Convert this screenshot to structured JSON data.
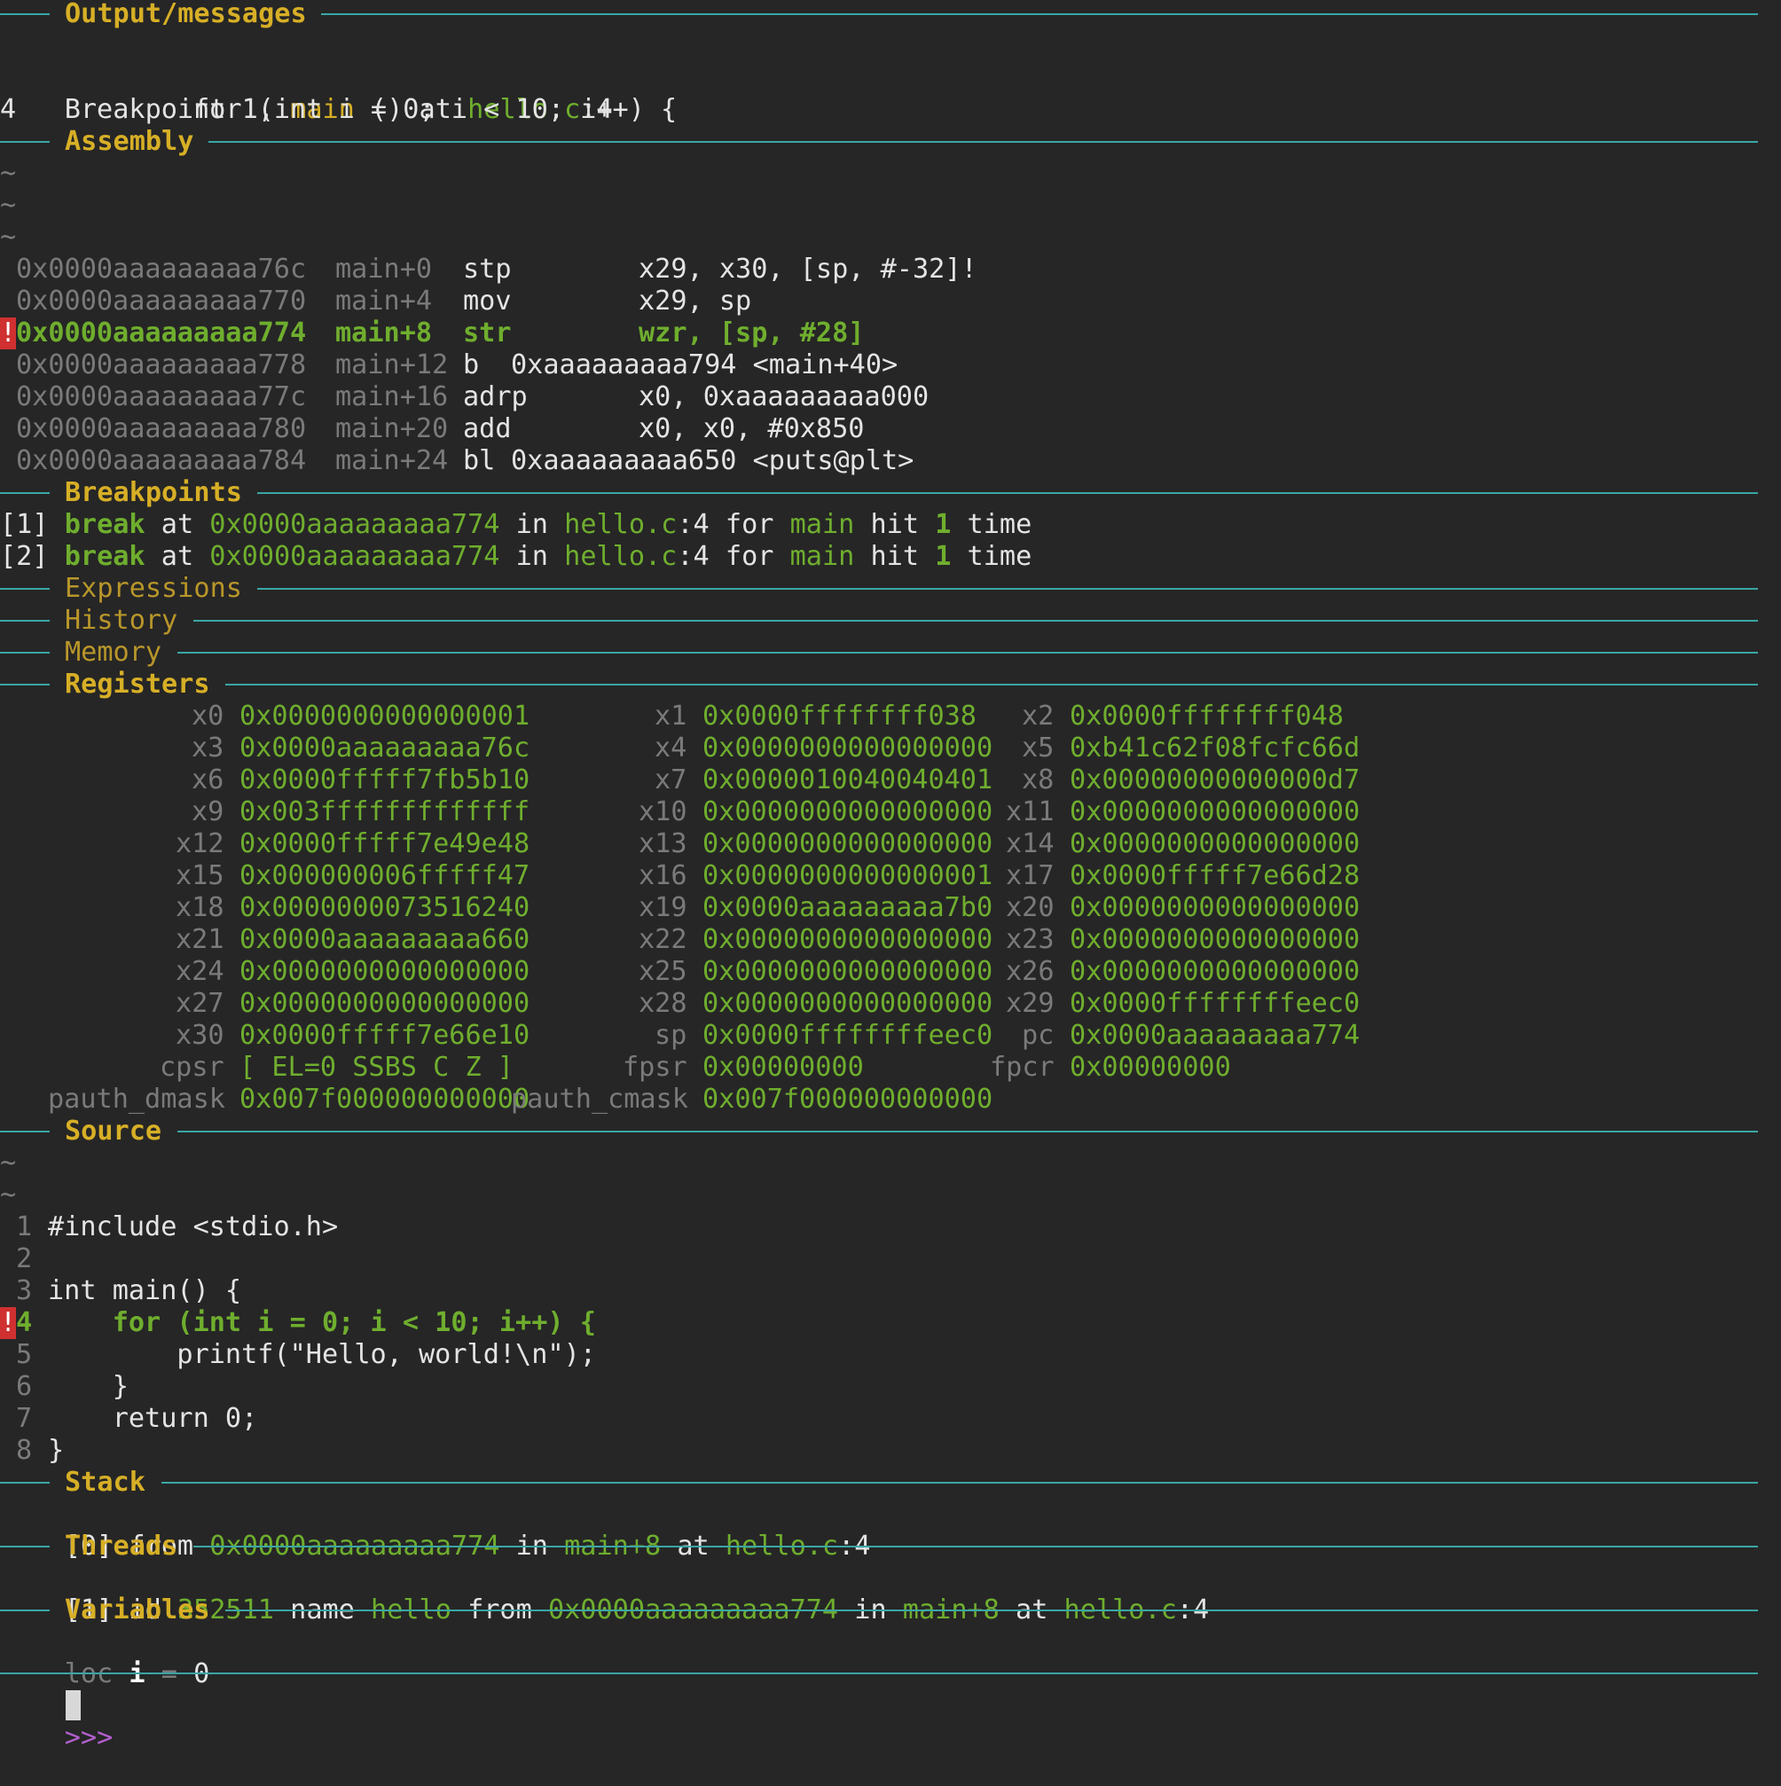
{
  "panels": {
    "output": "Output/messages",
    "assembly": "Assembly",
    "breakpoints": "Breakpoints",
    "expressions": "Expressions",
    "history": "History",
    "memory": "Memory",
    "registers": "Registers",
    "source": "Source",
    "stack": "Stack",
    "threads": "Threads",
    "variables": "Variables"
  },
  "output": {
    "bp_prefix": "Breakpoint 1, ",
    "func": "main",
    "mid": " () at ",
    "file": "hello.c",
    "line_suffix": ":4",
    "src_lineno": "4",
    "src_text": "for (int i = 0; i < 10; i++) {"
  },
  "tilde": "~",
  "bang": "!",
  "assembly": [
    {
      "addr": "0x0000aaaaaaaaa76c",
      "off": "main+0",
      "mn": "stp",
      "ops": "x29, x30, [sp, #-32]!"
    },
    {
      "addr": "0x0000aaaaaaaaa770",
      "off": "main+4",
      "mn": "mov",
      "ops": "x29, sp"
    },
    {
      "addr": "0x0000aaaaaaaaa774",
      "off": "main+8",
      "mn": "str",
      "ops": "wzr, [sp, #28]"
    },
    {
      "addr": "0x0000aaaaaaaaa778",
      "off": "main+12",
      "mn": "b",
      "ops": "0xaaaaaaaaa794 <main+40>"
    },
    {
      "addr": "0x0000aaaaaaaaa77c",
      "off": "main+16",
      "mn": "adrp",
      "ops": "x0, 0xaaaaaaaaa000"
    },
    {
      "addr": "0x0000aaaaaaaaa780",
      "off": "main+20",
      "mn": "add",
      "ops": "x0, x0, #0x850"
    },
    {
      "addr": "0x0000aaaaaaaaa784",
      "off": "main+24",
      "mn": "bl",
      "ops": "0xaaaaaaaaa650 <puts@plt>"
    }
  ],
  "breakpoints": [
    {
      "num": "[1]",
      "kw": "break",
      "at": " at ",
      "addr": "0x0000aaaaaaaaa774",
      "in": " in ",
      "file": "hello.c",
      "line": ":4",
      "for": " for ",
      "func": "main",
      "hit": " hit ",
      "count": "1",
      "time": " time"
    },
    {
      "num": "[2]",
      "kw": "break",
      "at": " at ",
      "addr": "0x0000aaaaaaaaa774",
      "in": " in ",
      "file": "hello.c",
      "line": ":4",
      "for": " for ",
      "func": "main",
      "hit": " hit ",
      "count": "1",
      "time": " time"
    }
  ],
  "registers": [
    [
      {
        "n": "x0",
        "v": "0x0000000000000001"
      },
      {
        "n": "x1",
        "v": "0x0000ffffffff038"
      },
      {
        "n": "x2",
        "v": "0x0000ffffffff048"
      }
    ],
    [
      {
        "n": "x3",
        "v": "0x0000aaaaaaaaa76c"
      },
      {
        "n": "x4",
        "v": "0x0000000000000000"
      },
      {
        "n": "x5",
        "v": "0xb41c62f08fcfc66d"
      }
    ],
    [
      {
        "n": "x6",
        "v": "0x0000fffff7fb5b10"
      },
      {
        "n": "x7",
        "v": "0x0000010040040401"
      },
      {
        "n": "x8",
        "v": "0x00000000000000d7"
      }
    ],
    [
      {
        "n": "x9",
        "v": "0x003fffffffffffff"
      },
      {
        "n": "x10",
        "v": "0x0000000000000000"
      },
      {
        "n": "x11",
        "v": "0x0000000000000000"
      }
    ],
    [
      {
        "n": "x12",
        "v": "0x0000fffff7e49e48"
      },
      {
        "n": "x13",
        "v": "0x0000000000000000"
      },
      {
        "n": "x14",
        "v": "0x0000000000000000"
      }
    ],
    [
      {
        "n": "x15",
        "v": "0x000000006fffff47"
      },
      {
        "n": "x16",
        "v": "0x0000000000000001"
      },
      {
        "n": "x17",
        "v": "0x0000fffff7e66d28"
      }
    ],
    [
      {
        "n": "x18",
        "v": "0x0000000073516240"
      },
      {
        "n": "x19",
        "v": "0x0000aaaaaaaaa7b0"
      },
      {
        "n": "x20",
        "v": "0x0000000000000000"
      }
    ],
    [
      {
        "n": "x21",
        "v": "0x0000aaaaaaaaa660"
      },
      {
        "n": "x22",
        "v": "0x0000000000000000"
      },
      {
        "n": "x23",
        "v": "0x0000000000000000"
      }
    ],
    [
      {
        "n": "x24",
        "v": "0x0000000000000000"
      },
      {
        "n": "x25",
        "v": "0x0000000000000000"
      },
      {
        "n": "x26",
        "v": "0x0000000000000000"
      }
    ],
    [
      {
        "n": "x27",
        "v": "0x0000000000000000"
      },
      {
        "n": "x28",
        "v": "0x0000000000000000"
      },
      {
        "n": "x29",
        "v": "0x0000ffffffffeec0"
      }
    ],
    [
      {
        "n": "x30",
        "v": "0x0000fffff7e66e10"
      },
      {
        "n": "sp",
        "v": "0x0000ffffffffeec0"
      },
      {
        "n": "pc",
        "v": "0x0000aaaaaaaaa774"
      }
    ],
    [
      {
        "n": "cpsr",
        "v": "[ EL=0 SSBS C Z ]"
      },
      {
        "n": "fpsr",
        "v": "0x00000000"
      },
      {
        "n": "fpcr",
        "v": "0x00000000"
      }
    ],
    [
      {
        "n": "pauth_dmask",
        "v": "0x007f000000000000"
      },
      {
        "n": "pauth_cmask",
        "v": "0x007f000000000000"
      }
    ]
  ],
  "source": [
    {
      "no": "1",
      "text": "#include <stdio.h>"
    },
    {
      "no": "2",
      "text": ""
    },
    {
      "no": "3",
      "text": "int main() {"
    },
    {
      "no": "4",
      "text": "    for (int i = 0; i < 10; i++) {"
    },
    {
      "no": "5",
      "text": "        printf(\"Hello, world!\\n\");"
    },
    {
      "no": "6",
      "text": "    }"
    },
    {
      "no": "7",
      "text": "    return 0;"
    },
    {
      "no": "8",
      "text": "}"
    }
  ],
  "stack": {
    "num": "[0]",
    "from": " from ",
    "addr": "0x0000aaaaaaaaa774",
    "in": " in ",
    "func": "main+8",
    "at": " at ",
    "file": "hello.c",
    "line": ":4"
  },
  "thread": {
    "num": "[1]",
    "id_label": " id ",
    "id": "352511",
    "name_label": " name ",
    "name": "hello",
    "from": " from ",
    "addr": "0x0000aaaaaaaaa774",
    "in": " in ",
    "func": "main+8",
    "at": " at ",
    "file": "hello.c",
    "line": ":4"
  },
  "variables": {
    "kind": "loc",
    "name": "i",
    "eq": " = ",
    "value": "0"
  },
  "prompt": ">>>",
  "colors": {
    "background": "#262626",
    "rule": "#3aa6a6",
    "header": "#d7af26",
    "value": "#6fae2e",
    "dim": "#7a7a7a",
    "prompt": "#b35fd0",
    "breakpoint_marker": "#d03030"
  }
}
